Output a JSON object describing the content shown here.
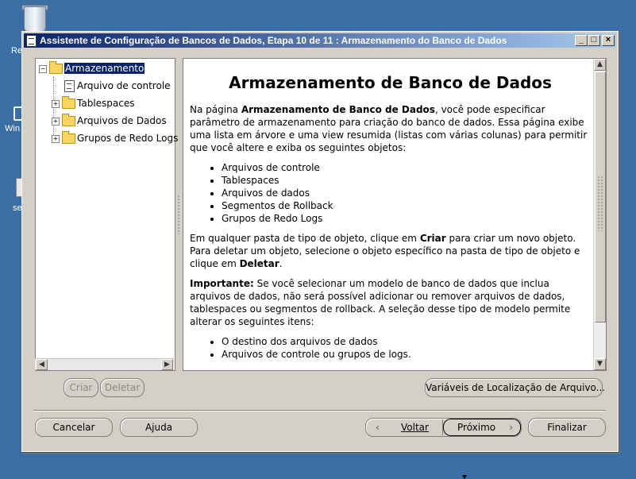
{
  "desktop": {
    "icon1_label": "Re",
    "icon2_label": "Win",
    "icon3_label": "se"
  },
  "window": {
    "title": "Assistente de Configuração de Bancos de Dados, Etapa 10 de 11 : Armazenamento do Banco de Dados",
    "min_glyph": "_",
    "max_glyph": "□",
    "close_glyph": "×"
  },
  "tree": {
    "root": "Armazenamento",
    "items": [
      {
        "label": "Arquivo de controle",
        "icon": "document-icon"
      },
      {
        "label": "Tablespaces",
        "icon": "folder-icon"
      },
      {
        "label": "Arquivos de Dados",
        "icon": "folder-icon"
      },
      {
        "label": "Grupos de Redo Logs",
        "icon": "folder-icon"
      }
    ],
    "expand_glyph": "+",
    "collapse_glyph": "−"
  },
  "content": {
    "heading": "Armazenamento de Banco de Dados",
    "p1_a": "Na página ",
    "p1_b": "Armazenamento de Banco de Dados",
    "p1_c": ", você pode especificar parâmetro de armazenamento para criação do banco de dados. Essa página exibe uma lista em árvore e uma view resumida (listas com várias colunas) para permitir que você altere e exiba os seguintes objetos:",
    "list1": [
      "Arquivos de controle",
      "Tablespaces",
      "Arquivos de dados",
      "Segmentos de Rollback",
      "Grupos de Redo Logs"
    ],
    "p2_a": "Em qualquer pasta de tipo de objeto, clique em ",
    "p2_b": "Criar",
    "p2_c": " para criar um novo objeto. Para deletar um objeto, selecione o objeto específico na pasta de tipo de objeto e clique em ",
    "p2_d": "Deletar",
    "p2_e": ".",
    "p3_a": "Importante:",
    "p3_b": " Se você selecionar um modelo de banco de dados que inclua arquivos de dados, não será possível adicionar ou remover arquivos de dados, tablespaces ou segmentos de rollback. A seleção desse tipo de modelo permite alterar os seguintes itens:",
    "list2": [
      "O destino dos arquivos de dados",
      "Arquivos de controle ou grupos de logs."
    ]
  },
  "buttons": {
    "create": "Criar",
    "delete": "Deletar",
    "file_location_vars": "Variáveis de Localização de Arquivo...",
    "cancel": "Cancelar",
    "help": "Ajuda",
    "back": "Voltar",
    "next": "Próximo",
    "finish": "Finalizar"
  }
}
